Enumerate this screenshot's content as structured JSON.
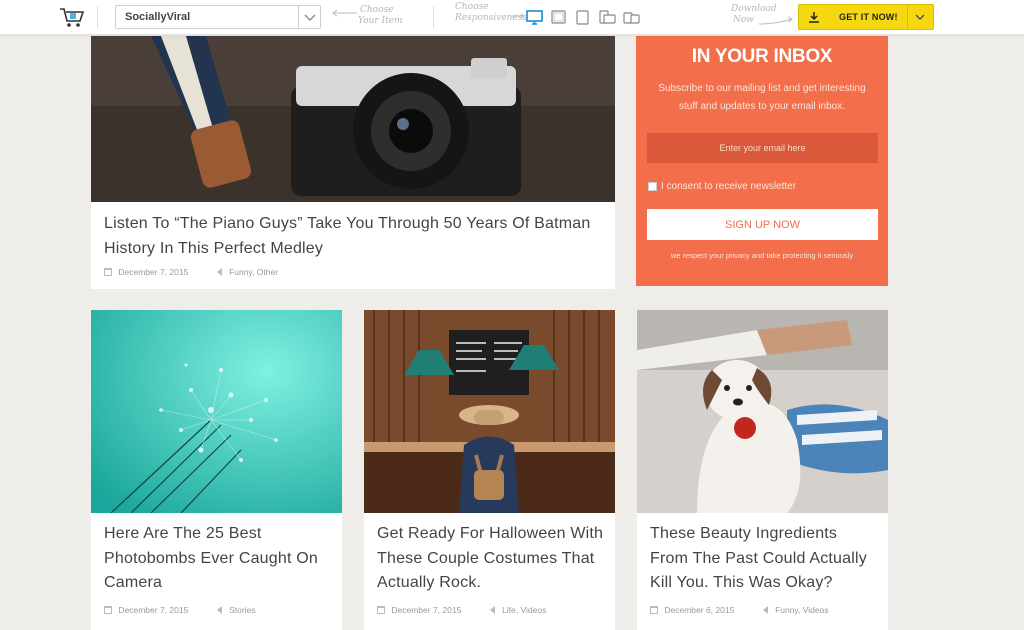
{
  "topbar": {
    "selected_item": "SociallyViral",
    "hint_choose_item": [
      "Choose",
      "Your Item"
    ],
    "hint_choose_responsive": [
      "Choose",
      "Responsiveness"
    ],
    "hint_download": [
      "Download",
      "Now"
    ],
    "devices": [
      "desktop-icon",
      "tablet-landscape-icon",
      "tablet-portrait-icon",
      "phone-landscape-icon",
      "phone-portrait-icon"
    ],
    "get_button_label": "GET IT NOW!",
    "accent_color": "#1a8ad4",
    "button_color": "#f5d80f"
  },
  "featured": {
    "title_line1": "Listen To “The Piano Guys” Take You Through 50 Years Of Batman",
    "title_line2": "History In This Perfect Medley",
    "date": "December 7, 2015",
    "categories": "Funny, Other"
  },
  "newsletter": {
    "title": "IN YOUR INBOX",
    "desc_line1": "Subscribe to our mailing list and get interesting",
    "desc_line2": "stuff and updates to your email inbox.",
    "email_placeholder": "Enter your email here",
    "consent_label": "I consent to receive newsletter",
    "signup_label": "SIGN UP NOW",
    "privacy_note": "we respect your privacy and take protecting it seriously",
    "background_color": "#f36e4a"
  },
  "posts": [
    {
      "lines": [
        "Here Are The 25 Best",
        "Photobombs Ever Caught On",
        "Camera"
      ],
      "date": "December 7, 2015",
      "categories": "Stories"
    },
    {
      "lines": [
        "Get Ready For Halloween With",
        "These Couple Costumes That",
        "Actually Rock."
      ],
      "date": "December 7, 2015",
      "categories": "Life, Videos"
    },
    {
      "lines": [
        "These Beauty Ingredients",
        "From The Past Could Actually",
        "Kill You. This Was Okay?"
      ],
      "date": "December 6, 2015",
      "categories": "Funny, Videos"
    }
  ]
}
